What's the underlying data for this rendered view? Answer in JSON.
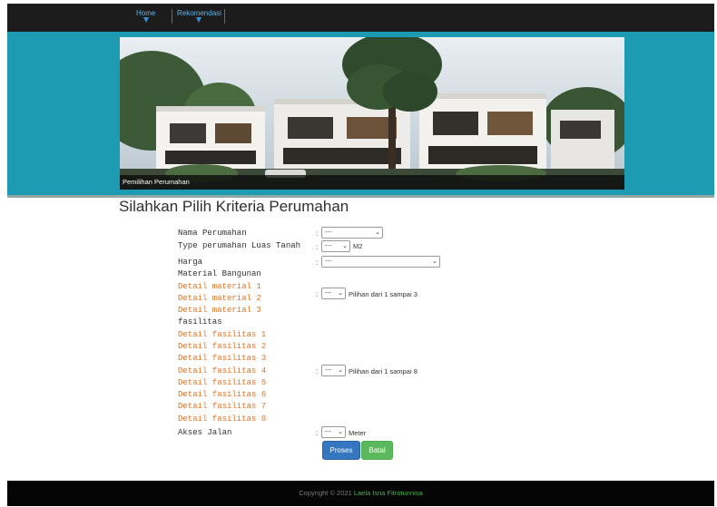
{
  "nav": {
    "home": "Home",
    "rekomendasi": "Rekomendasi"
  },
  "banner": {
    "caption": "Pemilihan Perumahan"
  },
  "form": {
    "title": "Silahkan Pilih Kriteria Perumahan",
    "labels": {
      "nama": "Nama Perumahan",
      "type": "Type perumahan Luas Tanah",
      "harga": "Harga",
      "material": "Material Bangunan",
      "fasilitas": "fasilitas",
      "akses": "Akses Jalan"
    },
    "material_details": [
      "Detail material 1",
      "Detail material 2",
      "Detail material 3"
    ],
    "fasilitas_details": [
      "Detail fasilitas 1",
      "Detail fasilitas 2",
      "Detail fasilitas 3",
      "Detail fasilitas 4",
      "Detail fasilitas 5",
      "Detail fasilitas 6",
      "Detail fasilitas 7",
      "Detail fasilitas 8"
    ],
    "colon": ":",
    "select_default": "---",
    "units": {
      "luas": "M2",
      "akses": "Meter"
    },
    "hints": {
      "material": "Pilihan dari 1 sampai 3",
      "fasilitas": "Pilihan dari 1 sampai 8"
    },
    "buttons": {
      "proses": "Proses",
      "batal": "Batal"
    }
  },
  "footer": {
    "copyright": "Copyright © 2021",
    "author": "Laela Isna Fitrotunnisa"
  },
  "colors": {
    "band": "#1d9bb3",
    "detail_text": "#e0752a",
    "proses": "#3476c0",
    "batal": "#5cb85c",
    "author": "#49b54a"
  }
}
